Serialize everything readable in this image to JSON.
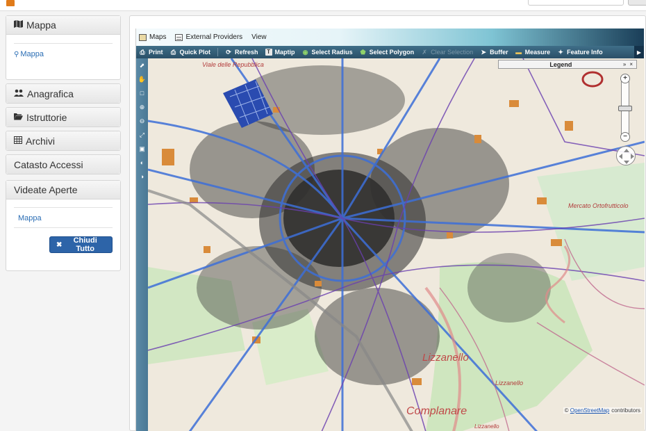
{
  "sidebar": {
    "map_panel": {
      "title": "Mappa",
      "link": "Mappa"
    },
    "sections": [
      {
        "label": "Anagrafica",
        "icon": "users-icon"
      },
      {
        "label": "Istruttorie",
        "icon": "folder-open-icon"
      },
      {
        "label": "Archivi",
        "icon": "table-icon"
      },
      {
        "label": "Catasto Accessi",
        "icon": ""
      }
    ],
    "open_views": {
      "title": "Videate Aperte",
      "item": "Mappa",
      "close_all": "Chiudi Tutto"
    }
  },
  "map": {
    "menu": [
      "Maps",
      "External Providers",
      "View"
    ],
    "tools": [
      {
        "label": "Print",
        "icon": "printer-icon",
        "enabled": true
      },
      {
        "label": "Quick Plot",
        "icon": "printer-icon",
        "enabled": true
      },
      {
        "label": "Refresh",
        "icon": "refresh-icon",
        "enabled": true
      },
      {
        "label": "Maptip",
        "icon": "maptip-icon",
        "enabled": true
      },
      {
        "label": "Select Radius",
        "icon": "select-radius-icon",
        "enabled": true
      },
      {
        "label": "Select Polygon",
        "icon": "select-polygon-icon",
        "enabled": true
      },
      {
        "label": "Clear Selection",
        "icon": "clear-selection-icon",
        "enabled": false
      },
      {
        "label": "Buffer",
        "icon": "buffer-icon",
        "enabled": true
      },
      {
        "label": "Measure",
        "icon": "ruler-icon",
        "enabled": true
      },
      {
        "label": "Feature Info",
        "icon": "feature-info-icon",
        "enabled": true
      }
    ],
    "legend_title": "Legend",
    "labels": [
      "Viale delle Repubblica",
      "Mercato Ortofrutticolo",
      "Lizzanello",
      "Lizzanello",
      "Complanare",
      "Lizzanello"
    ],
    "attribution": {
      "symbol": "©",
      "link": "OpenStreetMap",
      "suffix": "contributors"
    }
  },
  "colors": {
    "accent": "#2d64a8",
    "toolbar": "#2a5068",
    "building": "#111111",
    "roads": "#4a6fd0"
  }
}
